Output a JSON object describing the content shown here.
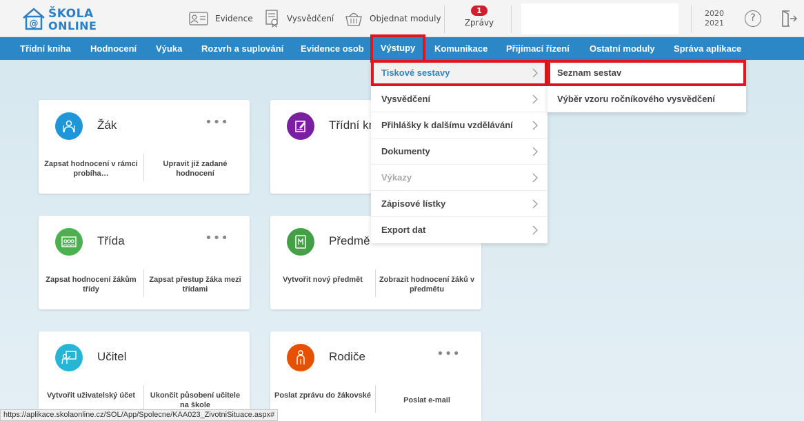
{
  "header": {
    "logo_line1": "ŠKOLA",
    "logo_line2": "ONLINE",
    "evidence_label": "Evidence",
    "vysvedceni_label": "Vysvědčení",
    "objednat_label": "Objednat moduly",
    "zpravy_label": "Zprávy",
    "zpravy_count": "1",
    "year_line1": "2020",
    "year_line2": "2021",
    "help_symbol": "?"
  },
  "nav": {
    "items": [
      {
        "label": "Třídní kniha"
      },
      {
        "label": "Hodnocení"
      },
      {
        "label": "Výuka"
      },
      {
        "label": "Rozvrh a suplování"
      },
      {
        "label": "Evidence osob"
      },
      {
        "label": "Výstupy"
      },
      {
        "label": "Komunikace"
      },
      {
        "label": "Přijímací řízení"
      },
      {
        "label": "Ostatní moduly"
      },
      {
        "label": "Správa aplikace"
      }
    ],
    "active": "Výstupy"
  },
  "cards": [
    {
      "title": "Žák",
      "dots": "•••",
      "action1": "Zapsat hodnocení v rámci probíha…",
      "action2": "Upravit již zadané hodnocení",
      "color": "#1e96d9"
    },
    {
      "title": "Třídní kn",
      "dots": "",
      "action1": "",
      "action2": "",
      "color": "#7b1fa2"
    },
    {
      "title": "Třída",
      "dots": "•••",
      "action1": "Zapsat hodnocení žákům třídy",
      "action2": "Zapsat přestup žáka mezi třídami",
      "color": "#4caf50"
    },
    {
      "title": "Předmě",
      "dots": "",
      "action1": "Vytvořit nový předmět",
      "action2": "Zobrazit hodnocení žáků v předmětu",
      "color": "#43a047"
    },
    {
      "title": "Učitel",
      "dots": "",
      "action1": "Vytvořit uživatelský účet",
      "action2": "Ukončit působení učitele na škole",
      "color": "#26b5d4"
    },
    {
      "title": "Rodiče",
      "dots": "•••",
      "action1": "Poslat zprávu do žákovské",
      "action2": "Poslat e-mail",
      "color": "#e65100"
    }
  ],
  "dropdown": {
    "items": [
      {
        "label": "Tiskové sestavy",
        "state": "selected"
      },
      {
        "label": "Vysvědčení",
        "state": "normal"
      },
      {
        "label": "Přihlášky k dalšímu vzdělávání",
        "state": "normal"
      },
      {
        "label": "Dokumenty",
        "state": "normal"
      },
      {
        "label": "Výkazy",
        "state": "disabled"
      },
      {
        "label": "Zápisové lístky",
        "state": "normal"
      },
      {
        "label": "Export dat",
        "state": "normal"
      }
    ]
  },
  "submenu": {
    "items": [
      {
        "label": "Seznam sestav",
        "state": "selected"
      },
      {
        "label": "Výběr vzoru ročníkového vysvědčení",
        "state": "normal"
      }
    ]
  },
  "status_url": "https://aplikace.skolaonline.cz/SOL/App/Spolecne/KAA023_ZivotniSituace.aspx#",
  "colors": {
    "nav": "#2c87c6",
    "highlight": "#e0151e",
    "badge": "#d31e2f"
  }
}
